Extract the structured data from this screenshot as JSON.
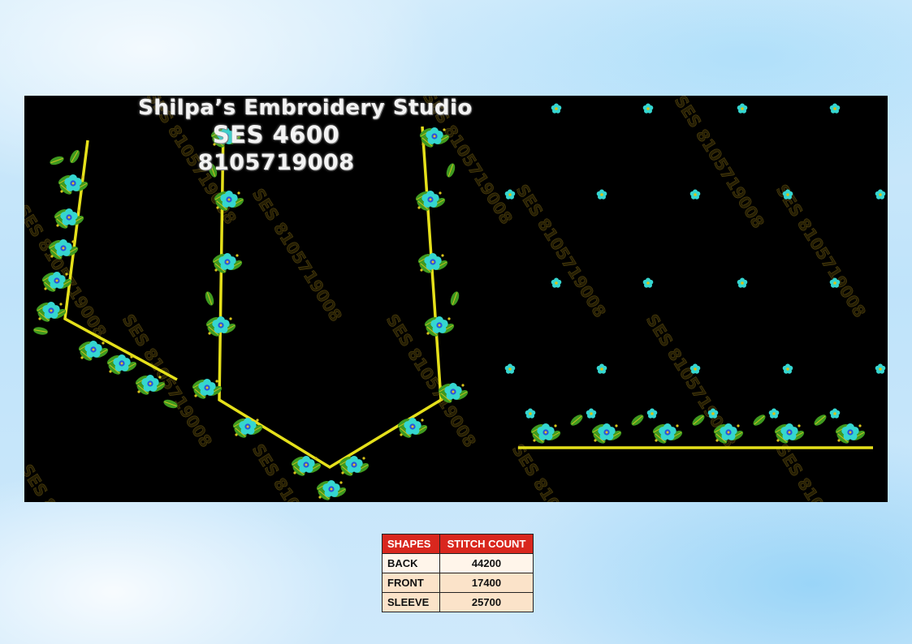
{
  "design": {
    "studio_name": "Shilpa’s Embroidery Studio",
    "design_code": "SES 4600",
    "phone": "8105719008",
    "watermark": "SES 8105719008",
    "colors": {
      "background": "#000000",
      "border": "#e5e01a",
      "leaf": "#3f9a1f",
      "flower": "#35d6d0",
      "flower_center": "#2c55d9",
      "dot": "#d8c31a"
    }
  },
  "stitch_table": {
    "headers": [
      "SHAPES",
      "STITCH COUNT"
    ],
    "rows": [
      {
        "shape": "BACK",
        "count": "44200"
      },
      {
        "shape": "FRONT",
        "count": "17400"
      },
      {
        "shape": "SLEEVE",
        "count": "25700"
      }
    ],
    "header_color": "#d9271e"
  }
}
